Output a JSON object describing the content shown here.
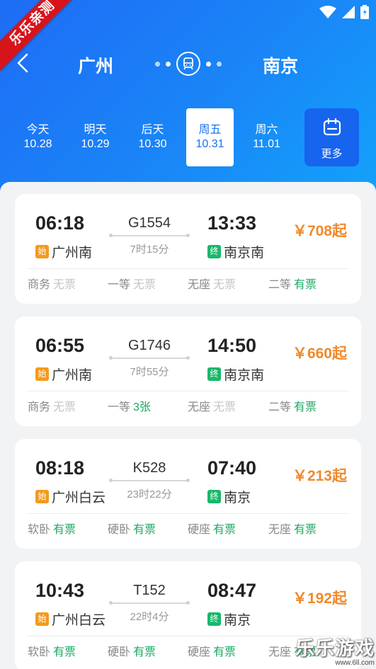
{
  "ribbon": "乐乐亲测",
  "header": {
    "from_city": "广州",
    "to_city": "南京"
  },
  "dates": [
    {
      "weekday": "今天",
      "date": "10.28",
      "active": false
    },
    {
      "weekday": "明天",
      "date": "10.29",
      "active": false
    },
    {
      "weekday": "后天",
      "date": "10.30",
      "active": false
    },
    {
      "weekday": "周五",
      "date": "10.31",
      "active": true
    },
    {
      "weekday": "周六",
      "date": "11.01",
      "active": false
    }
  ],
  "more_label": "更多",
  "tag_start": "始",
  "tag_end": "终",
  "trains": [
    {
      "dep_time": "06:18",
      "train_no": "G1554",
      "arr_time": "13:33",
      "duration": "7时15分",
      "dep_station": "广州南",
      "arr_station": "南京南",
      "price": "￥708起",
      "seats": [
        {
          "type": "商务",
          "status": "无票",
          "available": false
        },
        {
          "type": "一等",
          "status": "无票",
          "available": false
        },
        {
          "type": "无座",
          "status": "无票",
          "available": false
        },
        {
          "type": "二等",
          "status": "有票",
          "available": true
        }
      ]
    },
    {
      "dep_time": "06:55",
      "train_no": "G1746",
      "arr_time": "14:50",
      "duration": "7时55分",
      "dep_station": "广州南",
      "arr_station": "南京南",
      "price": "￥660起",
      "seats": [
        {
          "type": "商务",
          "status": "无票",
          "available": false
        },
        {
          "type": "一等",
          "status": "3张",
          "available": true
        },
        {
          "type": "无座",
          "status": "无票",
          "available": false
        },
        {
          "type": "二等",
          "status": "有票",
          "available": true
        }
      ]
    },
    {
      "dep_time": "08:18",
      "train_no": "K528",
      "arr_time": "07:40",
      "duration": "23时22分",
      "dep_station": "广州白云",
      "arr_station": "南京",
      "price": "￥213起",
      "seats": [
        {
          "type": "软卧",
          "status": "有票",
          "available": true
        },
        {
          "type": "硬卧",
          "status": "有票",
          "available": true
        },
        {
          "type": "硬座",
          "status": "有票",
          "available": true
        },
        {
          "type": "无座",
          "status": "有票",
          "available": true
        }
      ]
    },
    {
      "dep_time": "10:43",
      "train_no": "T152",
      "arr_time": "08:47",
      "duration": "22时4分",
      "dep_station": "广州白云",
      "arr_station": "南京",
      "price": "￥192起",
      "seats": [
        {
          "type": "软卧",
          "status": "有票",
          "available": true
        },
        {
          "type": "硬卧",
          "status": "有票",
          "available": true
        },
        {
          "type": "硬座",
          "status": "有票",
          "available": true
        },
        {
          "type": "无座",
          "status": "有票",
          "available": true
        }
      ]
    }
  ],
  "watermark": {
    "logo": "乐乐游戏",
    "url": "www.6ll.com"
  },
  "colors": {
    "primary": "#1a73f0",
    "price": "#f0892b",
    "available": "#1aa862",
    "start_tag": "#f39a1e",
    "end_tag": "#18b86a"
  }
}
